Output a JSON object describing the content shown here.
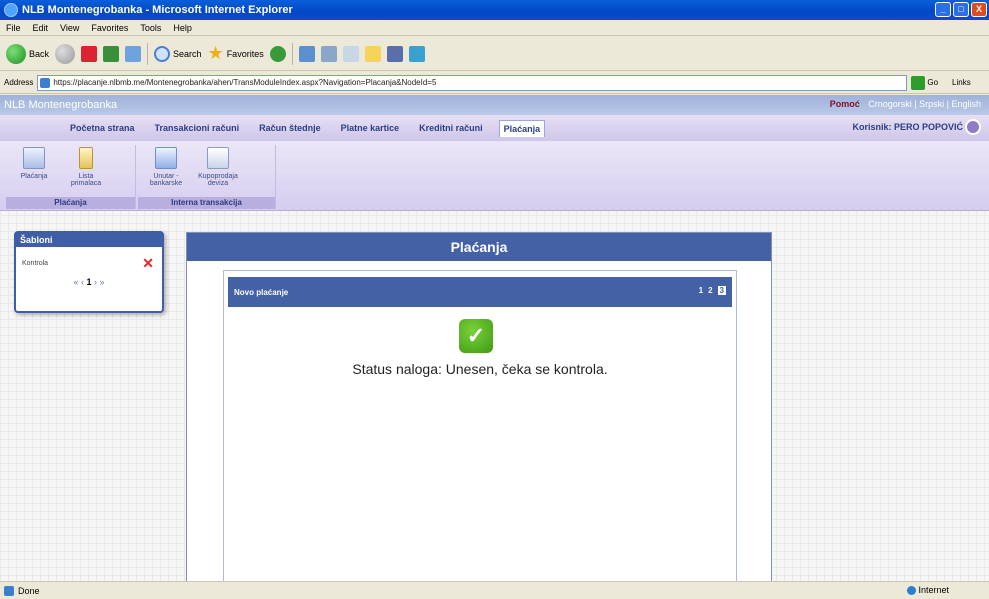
{
  "window": {
    "title": "NLB Montenegrobanka - Microsoft Internet Explorer",
    "buttons": [
      "_",
      "□",
      "X"
    ]
  },
  "menubar": [
    "File",
    "Edit",
    "View",
    "Favorites",
    "Tools",
    "Help"
  ],
  "toolbar": {
    "back": "Back",
    "search": "Search",
    "favorites": "Favorites"
  },
  "address": {
    "label": "Address",
    "url": "https://placanje.nlbmb.me/Montenegrobanka/ahen/TransModuleIndex.aspx?Navigation=Placanja&NodeId=5",
    "go": "Go",
    "links": "Links"
  },
  "site": {
    "logo": "NLB Montenegrobanka",
    "links": [
      "Pomoć",
      "Crnogorski | Srpski | English"
    ]
  },
  "nav": {
    "tabs": [
      "Početna strana",
      "Transakcioni računi",
      "Račun štednje",
      "Platne kartice",
      "Kreditni računi",
      "Plaćanja"
    ],
    "active": "Plaćanja",
    "user": "Korisnik: PERO POPOVIĆ"
  },
  "ribbon": {
    "groups": [
      {
        "label": "Plaćanja",
        "items": [
          "Plaćanja",
          "Lista primalaca"
        ]
      },
      {
        "label": "Interna transakcija",
        "items": [
          "Unutar - bankarske",
          "Kupoprodaja deviza"
        ]
      }
    ]
  },
  "sablon": {
    "title": "Šabloni",
    "item": "Kontrola",
    "pager_prev": "« ‹",
    "pager_current": "1",
    "pager_next": "› »"
  },
  "main": {
    "title": "Plaćanja",
    "subpanel_title": "Novo plaćanje",
    "steps": [
      "1",
      "2",
      "3"
    ],
    "current_step": "3",
    "status": "Status naloga: Unesen, čeka se kontrola."
  },
  "statusbar": {
    "left": "Done",
    "zone": "Internet"
  }
}
